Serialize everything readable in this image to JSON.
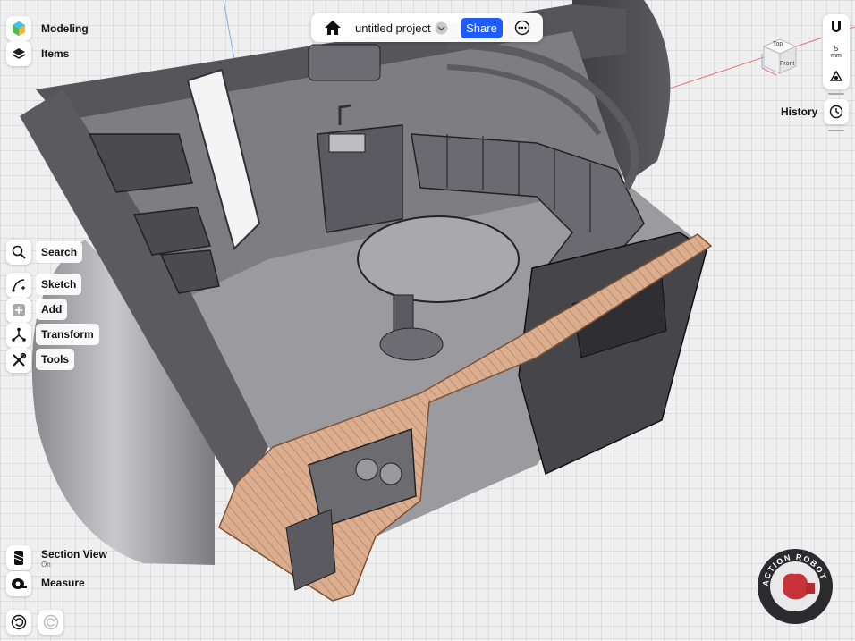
{
  "top_left": {
    "modeling_label": "Modeling",
    "items_label": "Items"
  },
  "project_bar": {
    "title": "untitled project",
    "share_label": "Share"
  },
  "left_toolbar": {
    "search_label": "Search",
    "sketch_label": "Sketch",
    "add_label": "Add",
    "transform_label": "Transform",
    "tools_label": "Tools"
  },
  "bottom_left": {
    "section_view_label": "Section View",
    "section_view_state": "On",
    "measure_label": "Measure"
  },
  "right_panel": {
    "grid_value": "5",
    "grid_unit": "mm",
    "history_label": "History",
    "view_cube": {
      "top_label": "Top",
      "front_label": "Front"
    }
  },
  "watermark": {
    "text": "ACTION ROBOT PUNCH"
  },
  "colors": {
    "accent": "#1f5bff",
    "section_fill": "#d8a98c",
    "model_gray": "#6e6e72"
  }
}
